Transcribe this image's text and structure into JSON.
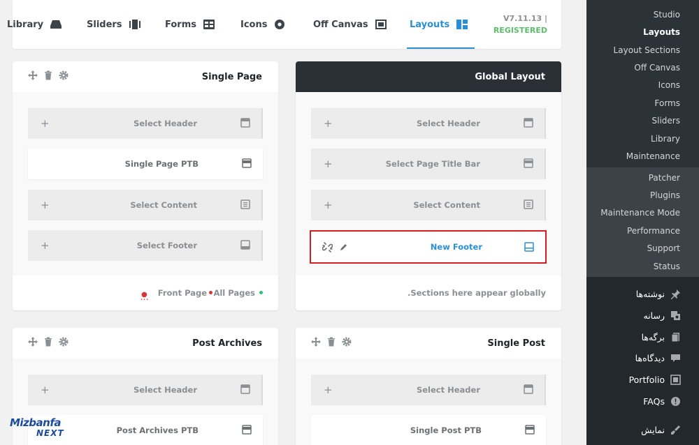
{
  "topnav": {
    "tabs": [
      {
        "label": "Library",
        "icon": "library-icon"
      },
      {
        "label": "Sliders",
        "icon": "sliders-icon"
      },
      {
        "label": "Forms",
        "icon": "forms-icon"
      },
      {
        "label": "Icons",
        "icon": "icons-icon"
      },
      {
        "label": "Off Canvas",
        "icon": "off-canvas-icon"
      },
      {
        "label": "Layouts",
        "icon": "layouts-icon",
        "active": true
      }
    ],
    "version": "V7.11.13 |",
    "registered": "REGISTERED"
  },
  "cards": {
    "single_page": {
      "title": "Single Page",
      "rows": [
        "Select Header",
        "Single Page PTB",
        "Select Content",
        "Select Footer"
      ],
      "footer_front": "Front Page",
      "footer_all": "All Pages"
    },
    "global_layout": {
      "title": "Global Layout",
      "rows": [
        "Select Header",
        "Select Page Title Bar",
        "Select Content",
        "New Footer"
      ],
      "footer_note": ".Sections here appear globally"
    },
    "post_archives": {
      "title": "Post Archives",
      "rows": [
        "Select Header",
        "Post Archives PTB"
      ]
    },
    "single_post": {
      "title": "Single Post",
      "rows": [
        "Select Header",
        "Single Post PTB"
      ]
    }
  },
  "sidebar": {
    "submenu_a": [
      "Studio",
      "Layouts",
      "Layout Sections",
      "Off Canvas",
      "Icons",
      "Forms",
      "Sliders",
      "Library",
      "Maintenance"
    ],
    "submenu_b": [
      "Patcher",
      "Plugins",
      "Maintenance Mode",
      "Performance",
      "Support",
      "Status"
    ],
    "menu": [
      {
        "label": "نوشته‌ها",
        "icon": "pin-icon"
      },
      {
        "label": "رسانه",
        "icon": "media-icon"
      },
      {
        "label": "برگه‌ها",
        "icon": "pages-icon"
      },
      {
        "label": "دیدگاه‌ها",
        "icon": "comments-icon"
      },
      {
        "label": "Portfolio",
        "icon": "portfolio-icon"
      },
      {
        "label": "FAQs",
        "icon": "faq-icon"
      },
      {
        "label": "نمایش",
        "icon": "appearance-icon"
      }
    ]
  },
  "watermark": {
    "line1": "Mizbanfa",
    "line2": "NEXT"
  },
  "colors": {
    "accent": "#2b8fd6",
    "registered": "#5bbf6a",
    "highlight_border": "#d71d1d",
    "sidebar": "#23282d"
  }
}
